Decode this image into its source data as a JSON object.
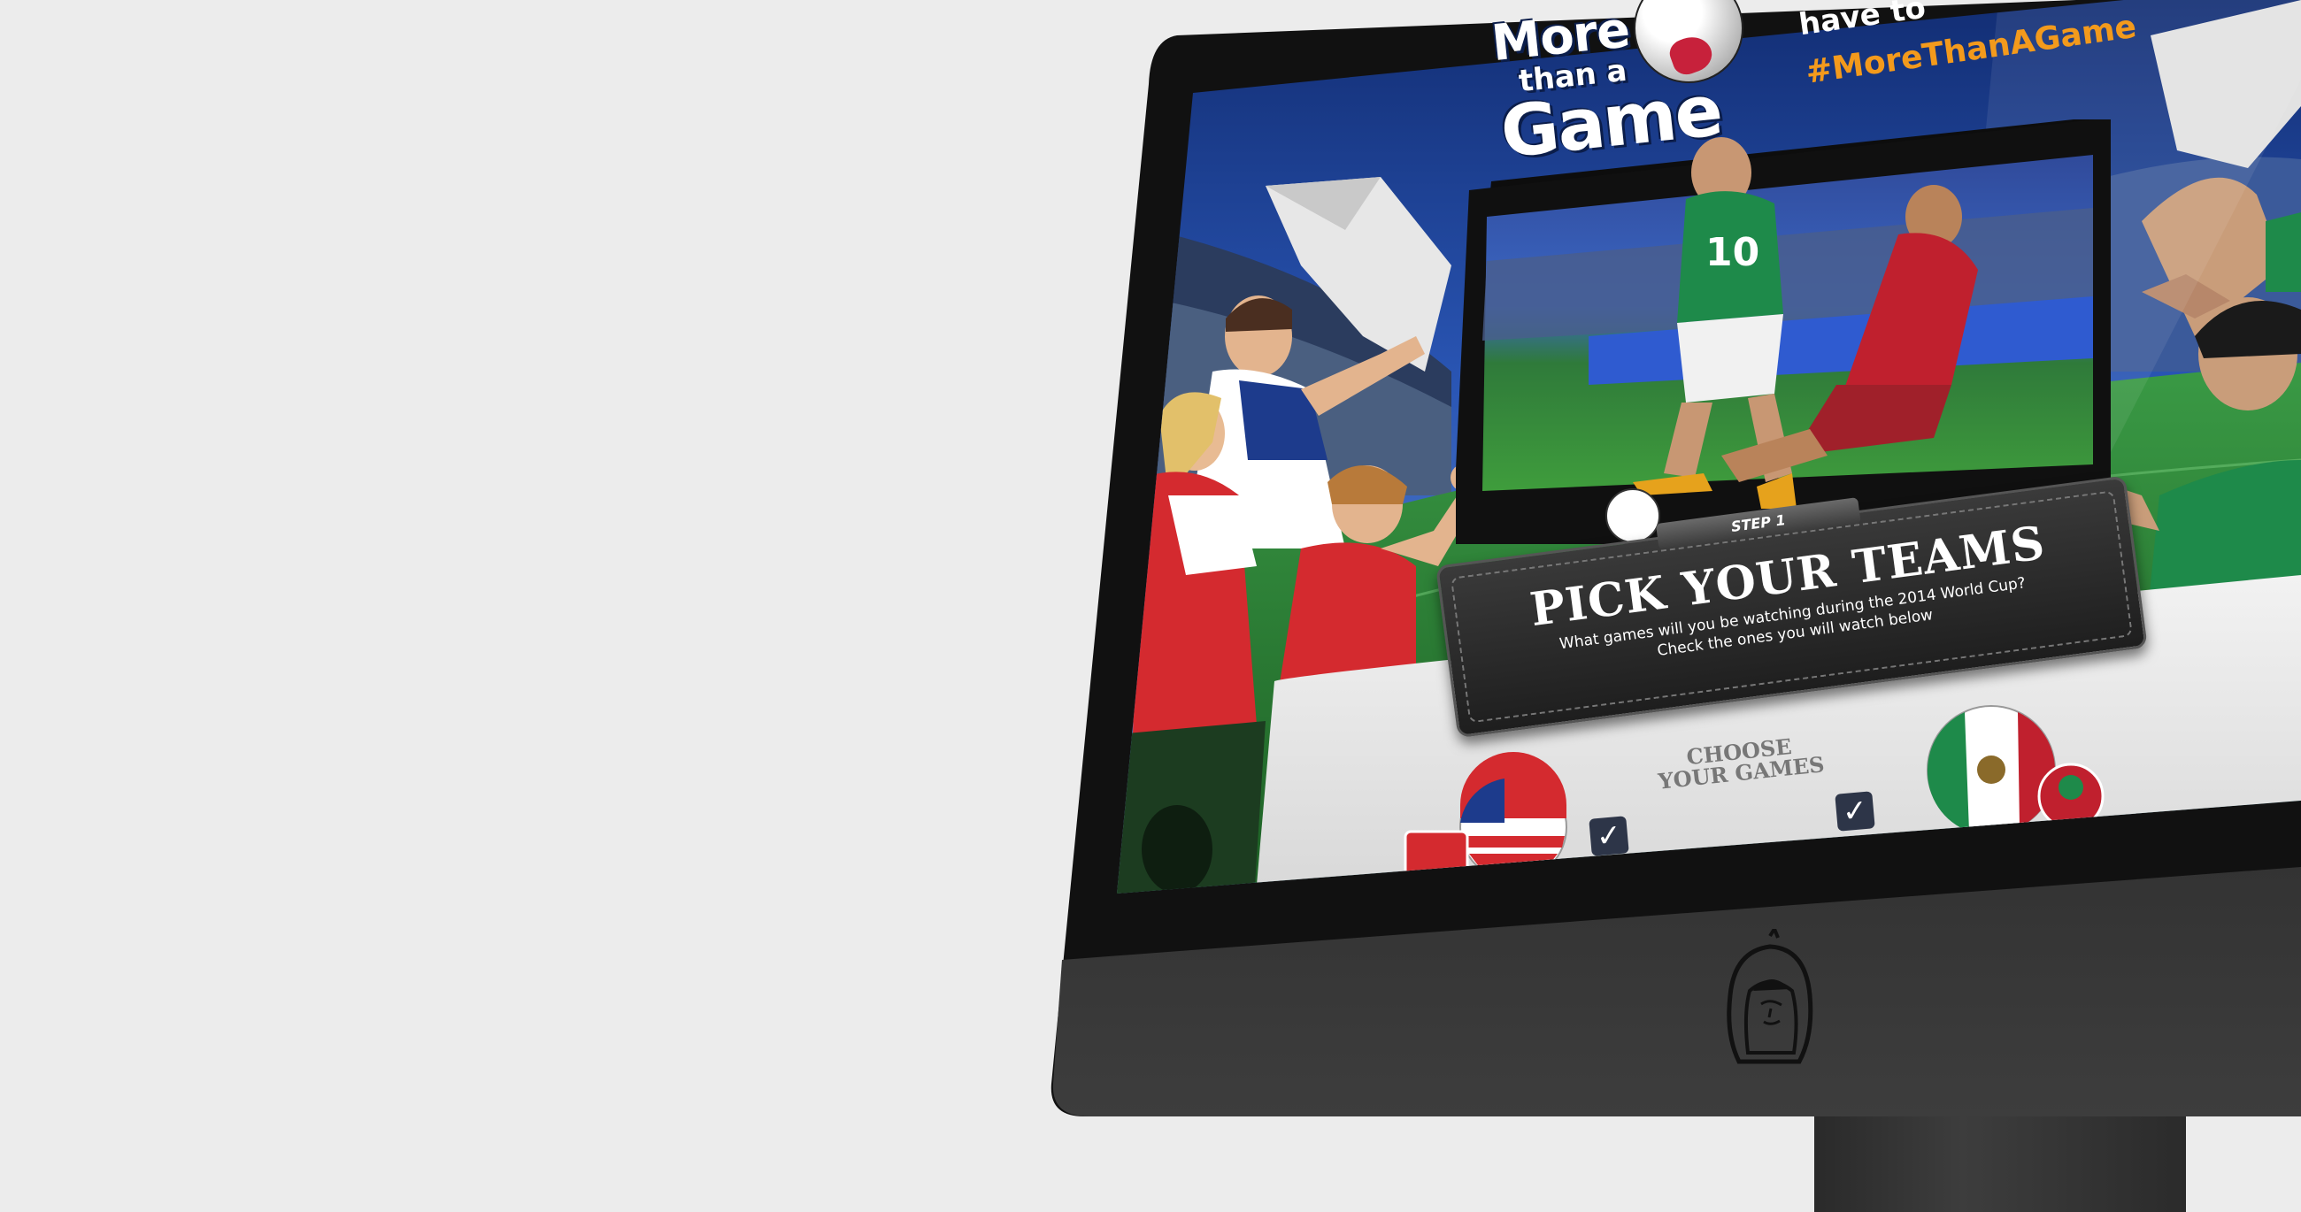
{
  "header": {
    "logo_line1": "More",
    "logo_line2": "than a",
    "logo_line3": "Game",
    "tagline": "have to",
    "hashtag": "#MoreThanAGame"
  },
  "tv": {
    "player_number": "10"
  },
  "step": {
    "tab_label": "STEP 1",
    "title": "PICK YOUR TEAMS",
    "subtitle_line1": "What games will you be watching during the 2014 World Cup?",
    "subtitle_line2": "Check the ones you will watch below"
  },
  "games": {
    "heading_line1": "CHOOSE",
    "heading_line2": "YOUR GAMES",
    "teams": [
      {
        "name": "USA",
        "checked": true
      },
      {
        "name": "Mexico",
        "checked": true
      }
    ]
  },
  "colors": {
    "sky_blue": "#2a56b5",
    "pitch_green": "#2f8a3a",
    "usa_red": "#d42a2f",
    "mexico_green": "#1e8a4a",
    "hashtag_orange": "#f39a1c",
    "monitor_body": "#3b3b3b"
  },
  "icons": {
    "check": "check-icon",
    "brand": "astronaut-helmet-logo"
  }
}
